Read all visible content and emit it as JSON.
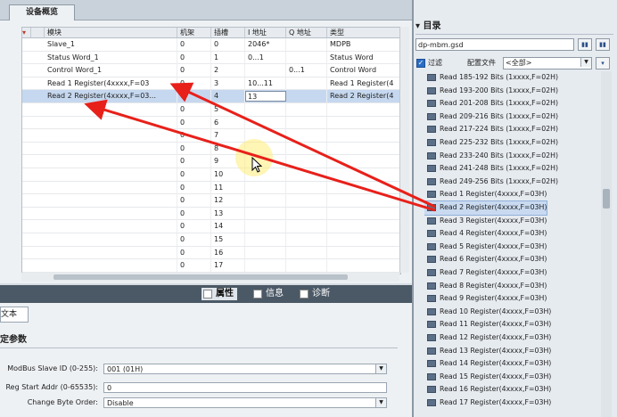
{
  "device_overview": {
    "tab_label": "设备概览",
    "columns": [
      "模块",
      "机架",
      "插槽",
      "I 地址",
      "Q 地址",
      "类型"
    ],
    "rows": [
      {
        "module": "Slave_1",
        "rack": "0",
        "slot": "0",
        "i_addr": "2046*",
        "q_addr": "",
        "type": "MDPB"
      },
      {
        "module": "Status Word_1",
        "rack": "0",
        "slot": "1",
        "i_addr": "0...1",
        "q_addr": "",
        "type": "Status Word"
      },
      {
        "module": "Control Word_1",
        "rack": "0",
        "slot": "2",
        "i_addr": "",
        "q_addr": "0...1",
        "type": "Control Word"
      },
      {
        "module": "Read 1 Register(4xxxx,F=03",
        "rack": "0",
        "slot": "3",
        "i_addr": "10...11",
        "q_addr": "",
        "type": "Read 1 Register(4"
      },
      {
        "module": "Read 2 Register(4xxxx,F=03...",
        "rack": "0",
        "slot": "4",
        "i_addr": "13",
        "q_addr": "",
        "type": "Read 2 Register(4"
      },
      {
        "module": "",
        "rack": "0",
        "slot": "5",
        "i_addr": "",
        "q_addr": "",
        "type": ""
      },
      {
        "module": "",
        "rack": "0",
        "slot": "6",
        "i_addr": "",
        "q_addr": "",
        "type": ""
      },
      {
        "module": "",
        "rack": "0",
        "slot": "7",
        "i_addr": "",
        "q_addr": "",
        "type": ""
      },
      {
        "module": "",
        "rack": "0",
        "slot": "8",
        "i_addr": "",
        "q_addr": "",
        "type": ""
      },
      {
        "module": "",
        "rack": "0",
        "slot": "9",
        "i_addr": "",
        "q_addr": "",
        "type": ""
      },
      {
        "module": "",
        "rack": "0",
        "slot": "10",
        "i_addr": "",
        "q_addr": "",
        "type": ""
      },
      {
        "module": "",
        "rack": "0",
        "slot": "11",
        "i_addr": "",
        "q_addr": "",
        "type": ""
      },
      {
        "module": "",
        "rack": "0",
        "slot": "12",
        "i_addr": "",
        "q_addr": "",
        "type": ""
      },
      {
        "module": "",
        "rack": "0",
        "slot": "13",
        "i_addr": "",
        "q_addr": "",
        "type": ""
      },
      {
        "module": "",
        "rack": "0",
        "slot": "14",
        "i_addr": "",
        "q_addr": "",
        "type": ""
      },
      {
        "module": "",
        "rack": "0",
        "slot": "15",
        "i_addr": "",
        "q_addr": "",
        "type": ""
      },
      {
        "module": "",
        "rack": "0",
        "slot": "16",
        "i_addr": "",
        "q_addr": "",
        "type": ""
      },
      {
        "module": "",
        "rack": "0",
        "slot": "17",
        "i_addr": "",
        "q_addr": "",
        "type": ""
      }
    ]
  },
  "properties": {
    "tabs": [
      {
        "label": "属性",
        "icon": "properties-icon"
      },
      {
        "label": "信息",
        "icon": "info-icon"
      },
      {
        "label": "诊断",
        "icon": "diagnostics-icon"
      }
    ],
    "text_tab": "文本",
    "section_title": "定参数",
    "params": [
      {
        "label": "ModBus Slave ID (0-255):",
        "value": "001 (01H)",
        "dropdown": true
      },
      {
        "label": "Reg Start Addr (0-65535):",
        "value": "0",
        "dropdown": false
      },
      {
        "label": "Change Byte Order:",
        "value": "Disable",
        "dropdown": true
      }
    ]
  },
  "catalog": {
    "title": "目录",
    "search_value": "dp-mbm.gsd",
    "filter_label": "过滤",
    "profile_label": "配置文件",
    "profile_value": "<全部>",
    "items": [
      "Read 185-192 Bits (1xxxx,F=02H)",
      "Read 193-200 Bits (1xxxx,F=02H)",
      "Read 201-208 Bits (1xxxx,F=02H)",
      "Read 209-216 Bits (1xxxx,F=02H)",
      "Read 217-224 Bits (1xxxx,F=02H)",
      "Read 225-232 Bits (1xxxx,F=02H)",
      "Read 233-240 Bits (1xxxx,F=02H)",
      "Read 241-248 Bits (1xxxx,F=02H)",
      "Read 249-256 Bits (1xxxx,F=02H)",
      "Read 1 Register(4xxxx,F=03H)",
      "Read 2 Register(4xxxx,F=03H)",
      "Read 3 Register(4xxxx,F=03H)",
      "Read 4 Register(4xxxx,F=03H)",
      "Read 5 Register(4xxxx,F=03H)",
      "Read 6 Register(4xxxx,F=03H)",
      "Read 7 Register(4xxxx,F=03H)",
      "Read 8 Register(4xxxx,F=03H)",
      "Read 9 Register(4xxxx,F=03H)",
      "Read 10 Register(4xxxx,F=03H)",
      "Read 11 Register(4xxxx,F=03H)",
      "Read 12 Register(4xxxx,F=03H)",
      "Read 13 Register(4xxxx,F=03H)",
      "Read 14 Register(4xxxx,F=03H)",
      "Read 15 Register(4xxxx,F=03H)",
      "Read 16 Register(4xxxx,F=03H)",
      "Read 17 Register(4xxxx,F=03H)"
    ],
    "selected_index": 10
  },
  "colors": {
    "arrow": "#e8201a",
    "selection": "#c6d8ef",
    "accent": "#2b6cc4"
  }
}
